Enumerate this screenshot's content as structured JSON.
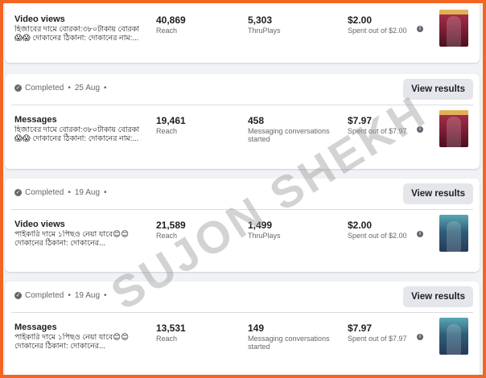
{
  "top_icons": [
    "flag-icon",
    "grid-icon",
    "megaphone-icon",
    "screen-icon"
  ],
  "cards": [
    {
      "status": "",
      "date": "",
      "button": "",
      "objective": "Video views",
      "description": "হিজাবের দামে বোরকা:৩৮০টাকায় বোরকা😱😱 দোকানের ঠিকানা: দোকানের নাম:...",
      "metric1_value": "40,869",
      "metric1_label": "Reach",
      "metric2_value": "5,303",
      "metric2_label": "ThruPlays",
      "spent_value": "$2.00",
      "spent_label": "Spent out of $2.00",
      "thumb": "pink-burqa"
    },
    {
      "status": "Completed",
      "date": "25 Aug",
      "button": "View results",
      "objective": "Messages",
      "description": "হিজাবের দামে বোরকা:৩৮০টাকায় বোরকা😱😱 দোকানের ঠিকানা: দোকানের নাম:...",
      "metric1_value": "19,461",
      "metric1_label": "Reach",
      "metric2_value": "458",
      "metric2_label": "Messaging conversations started",
      "spent_value": "$7.97",
      "spent_label": "Spent out of $7.97",
      "thumb": "pink-burqa"
    },
    {
      "status": "Completed",
      "date": "19 Aug",
      "button": "View results",
      "objective": "Video views",
      "description": "পাইকারি দামে ১পিছও নেয়া যাবে😊😊 দোকানের ঠিকানা: দোকানের...",
      "metric1_value": "21,589",
      "metric1_label": "Reach",
      "metric2_value": "1,499",
      "metric2_label": "ThruPlays",
      "spent_value": "$2.00",
      "spent_label": "Spent out of $2.00",
      "thumb": "teal-burqa"
    },
    {
      "status": "Completed",
      "date": "19 Aug",
      "button": "View results",
      "objective": "Messages",
      "description": "পাইকারি দামে ১পিছও নেয়া যাবে😊😊 দোকানের ঠিকানা: দোকানের...",
      "metric1_value": "13,531",
      "metric1_label": "Reach",
      "metric2_value": "149",
      "metric2_label": "Messaging conversations started",
      "spent_value": "$7.97",
      "spent_label": "Spent out of $7.97",
      "thumb": "teal-burqa"
    }
  ],
  "info_icon": "i",
  "check_icon": "✓",
  "separator": "•",
  "watermark": "SUJON SHEKH",
  "colors": {
    "frame": "#f26522",
    "button_bg": "#e4e6eb",
    "muted_text": "#65676b"
  }
}
